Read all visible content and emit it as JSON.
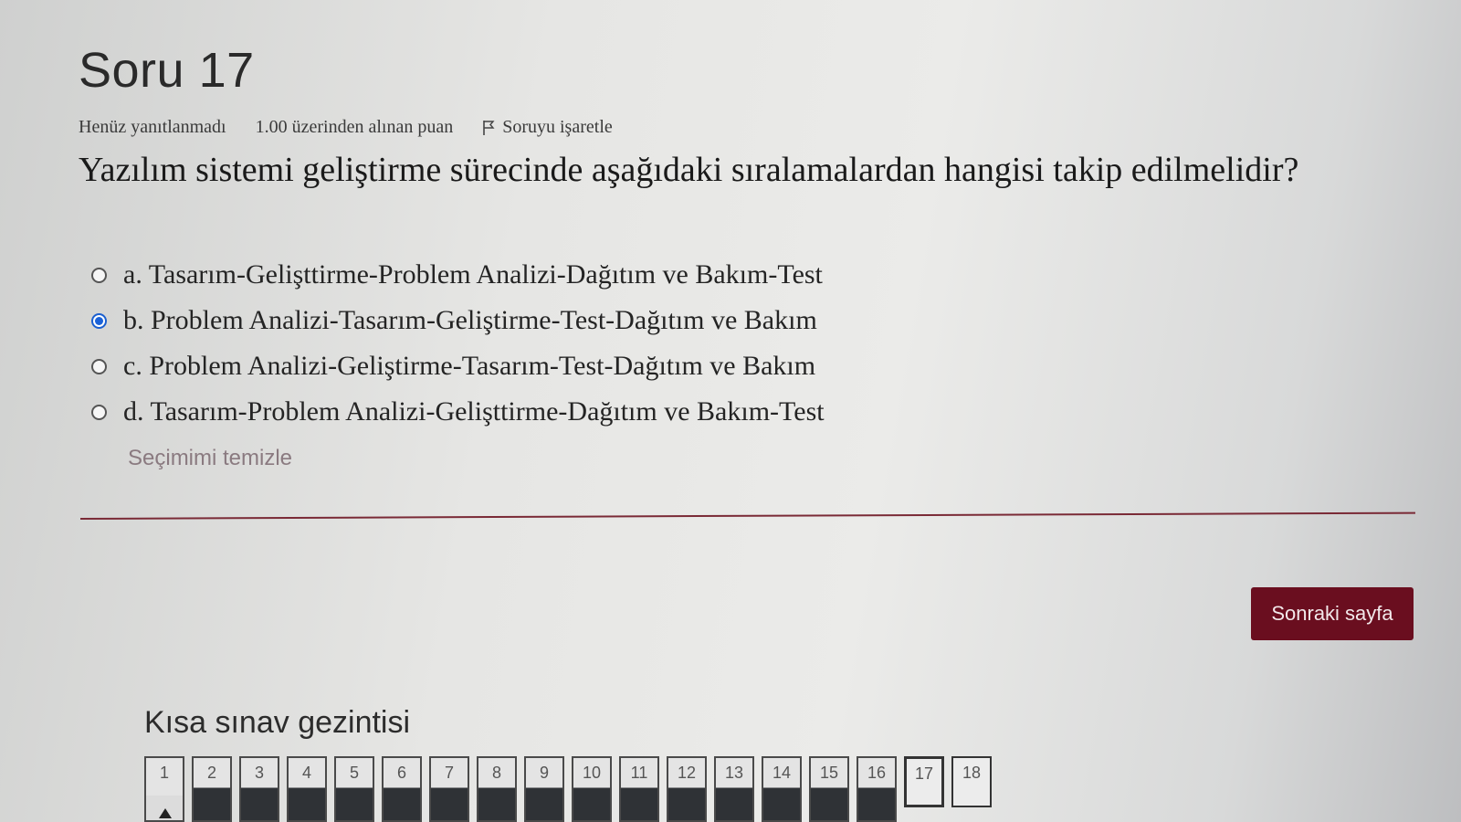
{
  "question": {
    "title": "Soru 17",
    "status": "Henüz yanıtlanmadı",
    "points": "1.00 üzerinden alınan puan",
    "flag_label": "Soruyu işaretle",
    "text": "Yazılım sistemi geliştirme sürecinde aşağıdaki sıralamalardan hangisi takip edilmelidir?"
  },
  "answers": [
    {
      "label": "a. Tasarım-Gelişttirme-Problem Analizi-Dağıtım ve Bakım-Test",
      "selected": false
    },
    {
      "label": "b. Problem Analizi-Tasarım-Geliştirme-Test-Dağıtım ve Bakım",
      "selected": true
    },
    {
      "label": "c. Problem Analizi-Geliştirme-Tasarım-Test-Dağıtım ve Bakım",
      "selected": false
    },
    {
      "label": "d. Tasarım-Problem Analizi-Gelişttirme-Dağıtım ve Bakım-Test",
      "selected": false
    }
  ],
  "clear_label": "Seçimimi temizle",
  "next_button": "Sonraki sayfa",
  "navigation": {
    "title": "Kısa sınav gezintisi",
    "buttons": [
      "1",
      "2",
      "3",
      "4",
      "5",
      "6",
      "7",
      "8",
      "9",
      "10",
      "11",
      "12",
      "13",
      "14",
      "15",
      "16",
      "17",
      "18"
    ],
    "current": "17"
  },
  "colors": {
    "accent": "#6a0e1f",
    "selected_radio": "#1b62d8"
  }
}
